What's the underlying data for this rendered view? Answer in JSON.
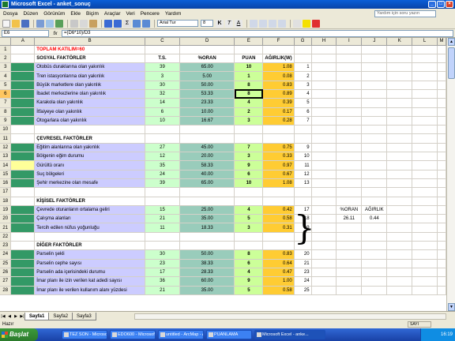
{
  "window": {
    "title": "Microsoft Excel - anket_sonuç"
  },
  "menu": [
    "Dosya",
    "Düzen",
    "Görünüm",
    "Ekle",
    "Biçim",
    "Araçlar",
    "Veri",
    "Pencere",
    "Yardım"
  ],
  "help_placeholder": "Yardım için soru yazın",
  "toolbar": {
    "font_name": "Arial Tur",
    "font_size": "8"
  },
  "formula_bar": {
    "name_box": "E6",
    "fx": "fx",
    "formula": "=(D6*10)/D3"
  },
  "columns": [
    "A",
    "B",
    "C",
    "D",
    "E",
    "F",
    "G",
    "H",
    "I",
    "J",
    "K",
    "L",
    "M"
  ],
  "selected": {
    "row": 6,
    "col": "E"
  },
  "rows": [
    {
      "n": 1,
      "type": "title",
      "B": "TOPLAM KATILIM=60"
    },
    {
      "n": 2,
      "type": "header",
      "B": "SOSYAL FAKTÖRLER",
      "C": "T.S.",
      "D": "%ORAN",
      "E": "PUAN",
      "F": "AĞIRLIK(W)"
    },
    {
      "n": 3,
      "type": "data",
      "bcolor": "lav",
      "B": "Otobüs duraklarına olan yakınlık",
      "C": "39",
      "D": "65.00",
      "E": "10",
      "F": "1.08",
      "G": "1"
    },
    {
      "n": 4,
      "type": "data",
      "bcolor": "lav",
      "B": "Tren istasyonlarına olan yakınlık",
      "C": "3",
      "D": "5.00",
      "E": "1",
      "F": "0.08",
      "G": "2"
    },
    {
      "n": 5,
      "type": "data",
      "bcolor": "lav",
      "B": "Büyük marketlere olan yakınlık",
      "C": "30",
      "D": "50.00",
      "E": "8",
      "F": "0.83",
      "G": "3"
    },
    {
      "n": 6,
      "type": "data",
      "bcolor": "lav",
      "B": "İbadet merkezlerine olan yakınlık",
      "C": "32",
      "D": "53.33",
      "E": "8",
      "F": "0.89",
      "G": "4"
    },
    {
      "n": 7,
      "type": "data",
      "bcolor": "lav",
      "B": "Karakola olan yakınlık",
      "C": "14",
      "D": "23.33",
      "E": "4",
      "F": "0.39",
      "G": "5"
    },
    {
      "n": 8,
      "type": "data",
      "bcolor": "lav",
      "B": "İtfaiyeye olan yakınlık",
      "C": "6",
      "D": "10.00",
      "E": "2",
      "F": "0.17",
      "G": "6"
    },
    {
      "n": 9,
      "type": "data",
      "bcolor": "lav",
      "B": "Otogarlara olan yakınlık",
      "C": "10",
      "D": "16.67",
      "E": "3",
      "F": "0.28",
      "G": "7"
    },
    {
      "n": 10,
      "type": "blank"
    },
    {
      "n": 11,
      "type": "section",
      "B": "ÇEVRESEL FAKTÖRLER"
    },
    {
      "n": 12,
      "type": "data",
      "bcolor": "lav",
      "B": "Eğitim alanlarına olan yakınlık",
      "C": "27",
      "D": "45.00",
      "E": "7",
      "F": "0.75",
      "G": "9"
    },
    {
      "n": 13,
      "type": "data",
      "bcolor": "lav",
      "B": "Bölgenin eğim durumu",
      "C": "12",
      "D": "20.00",
      "E": "3",
      "F": "0.33",
      "G": "10"
    },
    {
      "n": 14,
      "type": "data",
      "bcolor": "lav",
      "acolor": "yellow",
      "B": "Gürültü oranı",
      "C": "35",
      "D": "58.33",
      "E": "9",
      "F": "0.97",
      "G": "11"
    },
    {
      "n": 15,
      "type": "data",
      "bcolor": "lav",
      "B": "Suç bölgeleri",
      "C": "24",
      "D": "40.00",
      "E": "6",
      "F": "0.67",
      "G": "12"
    },
    {
      "n": 16,
      "type": "data",
      "bcolor": "lav",
      "B": "Şehir merkezine olan mesafe",
      "C": "39",
      "D": "65.00",
      "E": "10",
      "F": "1.08",
      "G": "13"
    },
    {
      "n": 17,
      "type": "blank"
    },
    {
      "n": 18,
      "type": "section",
      "B": "KİŞİSEL FAKTÖRLER"
    },
    {
      "n": 19,
      "type": "data",
      "bcolor": "lav",
      "B": "Çevrede oturanların ortalama geliri",
      "C": "15",
      "D": "25.00",
      "E": "4",
      "F": "0.42",
      "G": "17"
    },
    {
      "n": 20,
      "type": "data",
      "bcolor": "lav",
      "B": "Çalışma alanları",
      "C": "21",
      "D": "35.00",
      "E": "5",
      "F": "0.58",
      "G": "18",
      "I": "26.11",
      "J": "0.44"
    },
    {
      "n": 21,
      "type": "data",
      "bcolor": "lav",
      "B": "Tercih edilen nüfus yoğunluğu",
      "C": "11",
      "D": "18.33",
      "E": "3",
      "F": "0.31",
      "G": "19"
    },
    {
      "n": 22,
      "type": "blank"
    },
    {
      "n": 23,
      "type": "section",
      "B": "DİĞER FAKTÖRLER"
    },
    {
      "n": 24,
      "type": "data",
      "bcolor": "lav",
      "B": "Parselin şekli",
      "C": "30",
      "D": "50.00",
      "E": "8",
      "F": "0.83",
      "G": "20"
    },
    {
      "n": 25,
      "type": "data",
      "bcolor": "lav",
      "B": "Parselin cephe sayısı",
      "C": "23",
      "D": "38.33",
      "E": "6",
      "F": "0.64",
      "G": "21"
    },
    {
      "n": 26,
      "type": "data",
      "bcolor": "lav",
      "B": "Parselin ada içerisindeki durumu",
      "C": "17",
      "D": "28.33",
      "E": "4",
      "F": "0.47",
      "G": "23"
    },
    {
      "n": 27,
      "type": "data",
      "bcolor": "lav",
      "B": "İmar planı ile izin verilen kat adedi sayısı",
      "C": "36",
      "D": "60.00",
      "E": "9",
      "F": "1.00",
      "G": "24"
    },
    {
      "n": 28,
      "type": "data",
      "bcolor": "lav",
      "B": "İmar planı ile verilen kullanım alanı yüzdesi",
      "C": "21",
      "D": "35.00",
      "E": "5",
      "F": "0.58",
      "G": "25"
    }
  ],
  "side_labels": {
    "I": "%ORAN",
    "J": "AĞIRLIK"
  },
  "sheet_tabs": [
    "Sayfa1",
    "Sayfa2",
    "Sayfa3"
  ],
  "active_tab": "Sayfa1",
  "status": {
    "left": "Hazır",
    "right": "SAYI"
  },
  "taskbar": {
    "start": "Başlat",
    "items": [
      "TEZ SON - Microsoft ...",
      "EDO600 - Microsoft ...",
      "untitled - ArcMap - Ar...",
      "PUANLAMA",
      "Microsoft Excel - anke..."
    ],
    "clock": "16:19"
  },
  "colors": {
    "green": "#339966",
    "lavender": "#ccccff",
    "lightgreen": "#ccffcc",
    "teal": "#99ccbb",
    "lime": "#ccff99",
    "gold": "#ffcc33"
  }
}
